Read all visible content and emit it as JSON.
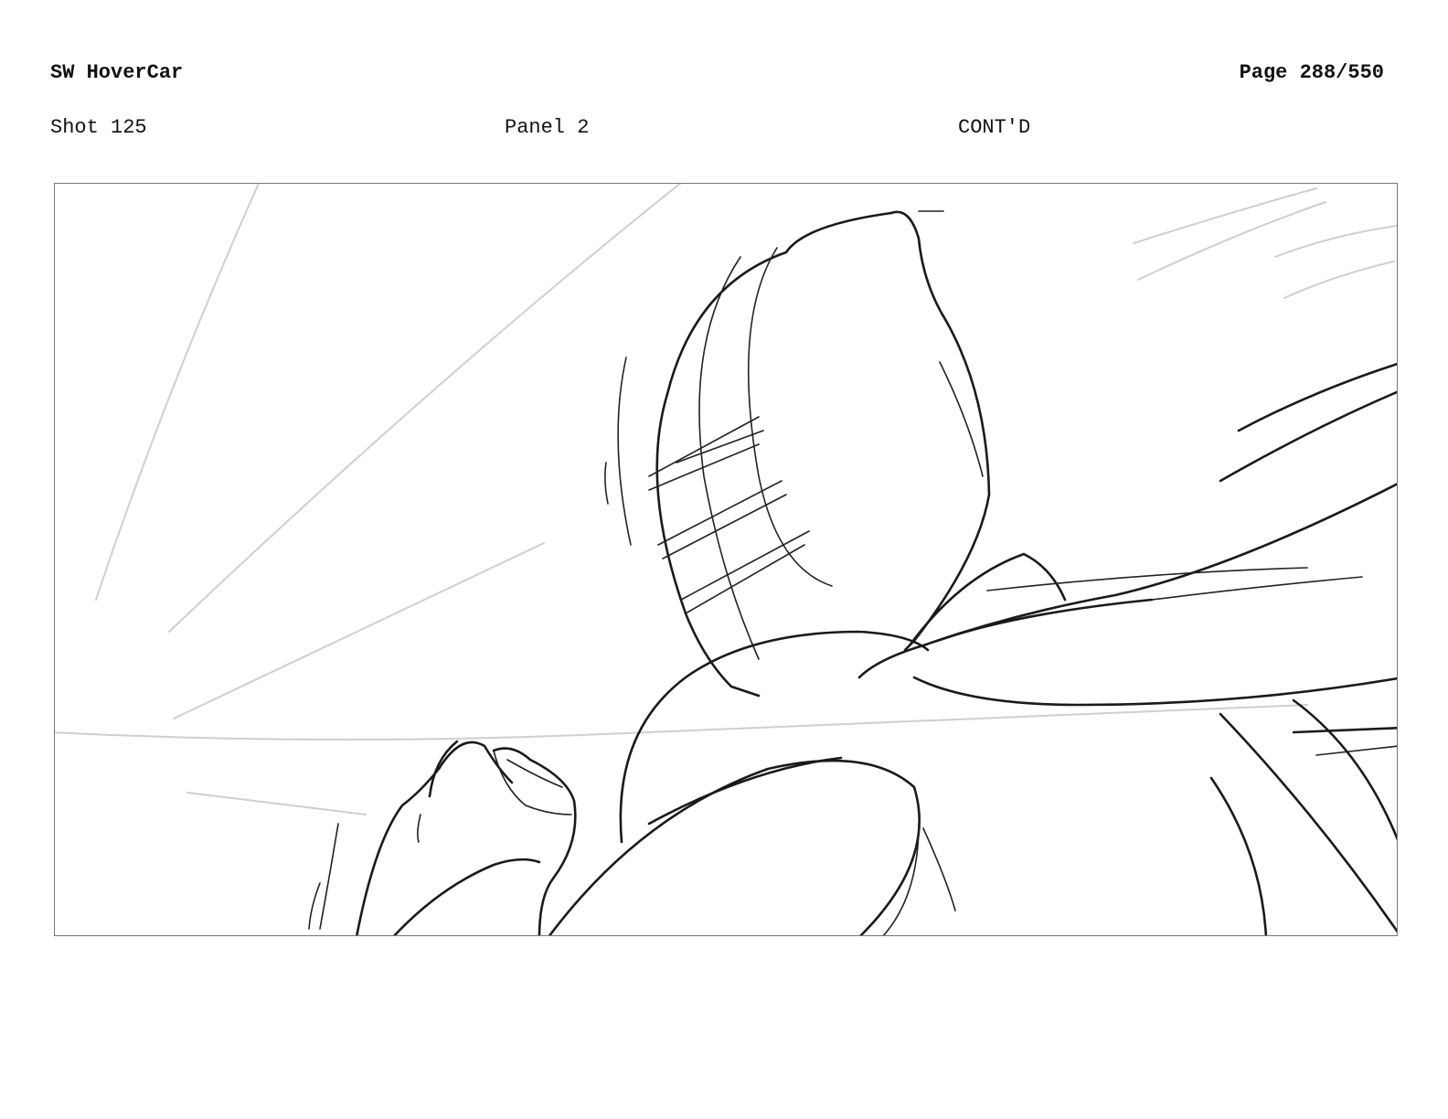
{
  "header": {
    "title": "SW HoverCar",
    "page": "Page 288/550"
  },
  "shot_info": {
    "shot": "Shot 125",
    "panel": "Panel 2",
    "continuity": "CONT'D"
  }
}
